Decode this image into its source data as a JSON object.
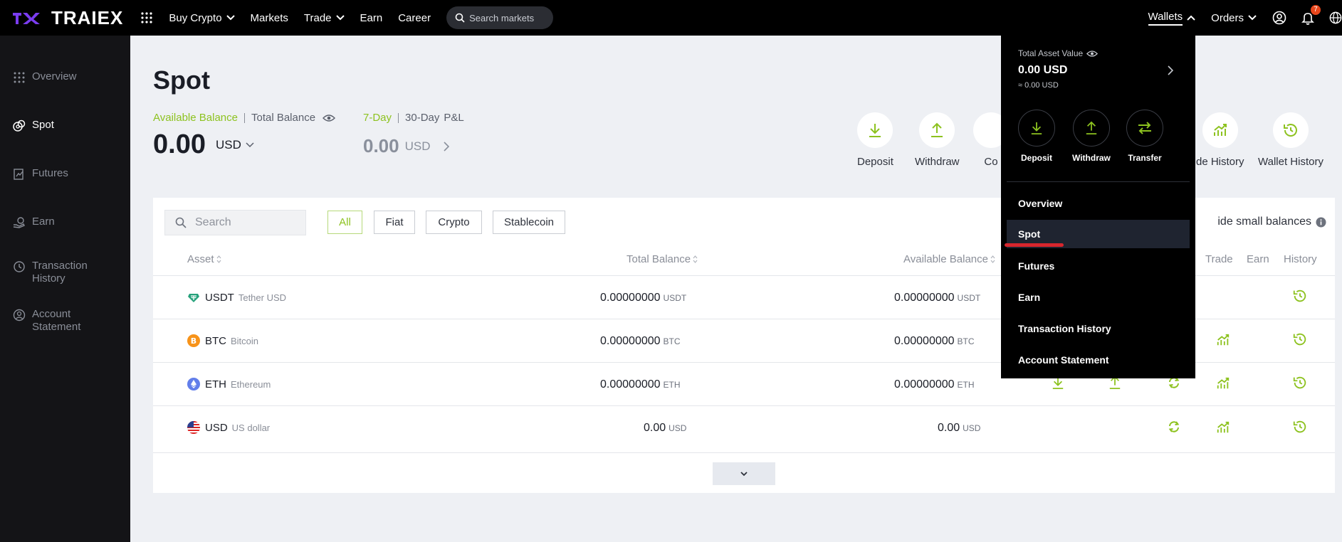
{
  "brand": {
    "name": "TRAIEX",
    "accent": "#8dc21f"
  },
  "topnav": {
    "items": [
      "Buy Crypto",
      "Markets",
      "Trade",
      "Earn",
      "Career"
    ],
    "search_placeholder": "Search markets",
    "right": {
      "wallets": "Wallets",
      "orders": "Orders",
      "notification_count": "7"
    }
  },
  "sidebar": {
    "items": [
      {
        "label": "Overview",
        "icon": "grid-icon"
      },
      {
        "label": "Spot",
        "icon": "coins-icon"
      },
      {
        "label": "Futures",
        "icon": "futures-icon"
      },
      {
        "label": "Earn",
        "icon": "earn-icon"
      },
      {
        "label": "Transaction History",
        "icon": "history-icon"
      },
      {
        "label": "Account Statement",
        "icon": "statement-icon"
      }
    ]
  },
  "page": {
    "title": "Spot",
    "balance_tabs": {
      "available": "Available Balance",
      "total": "Total Balance"
    },
    "balance_value": "0.00",
    "balance_currency": "USD",
    "pnl_tabs": {
      "seven_day": "7-Day",
      "thirty_day": "30-Day",
      "pnl": "P&L"
    },
    "pnl_value": "0.00",
    "pnl_currency": "USD",
    "actions": [
      "Deposit",
      "Withdraw",
      "Co",
      "de History",
      "Wallet History"
    ]
  },
  "table": {
    "search_placeholder": "Search",
    "filters": [
      "All",
      "Fiat",
      "Crypto",
      "Stablecoin"
    ],
    "hide_small": "ide small balances",
    "headers": {
      "asset": "Asset",
      "total": "Total Balance",
      "available": "Available Balance",
      "trade": "Trade",
      "earn": "Earn",
      "history": "History"
    },
    "rows": [
      {
        "symbol": "USDT",
        "name": "Tether USD",
        "total": "0.00000000",
        "available": "0.00000000",
        "unit": "USDT"
      },
      {
        "symbol": "BTC",
        "name": "Bitcoin",
        "total": "0.00000000",
        "available": "0.00000000",
        "unit": "BTC"
      },
      {
        "symbol": "ETH",
        "name": "Ethereum",
        "total": "0.00000000",
        "available": "0.00000000",
        "unit": "ETH"
      },
      {
        "symbol": "USD",
        "name": "US dollar",
        "total": "0.00",
        "available": "0.00",
        "unit": "USD"
      }
    ]
  },
  "wallet_menu": {
    "total_label": "Total Asset Value",
    "total_value": "0.00 USD",
    "approx": "≈ 0.00 USD",
    "actions": [
      "Deposit",
      "Withdraw",
      "Transfer"
    ],
    "items": [
      "Overview",
      "Spot",
      "Futures",
      "Earn",
      "Transaction History",
      "Account Statement"
    ],
    "selected": "Spot"
  }
}
